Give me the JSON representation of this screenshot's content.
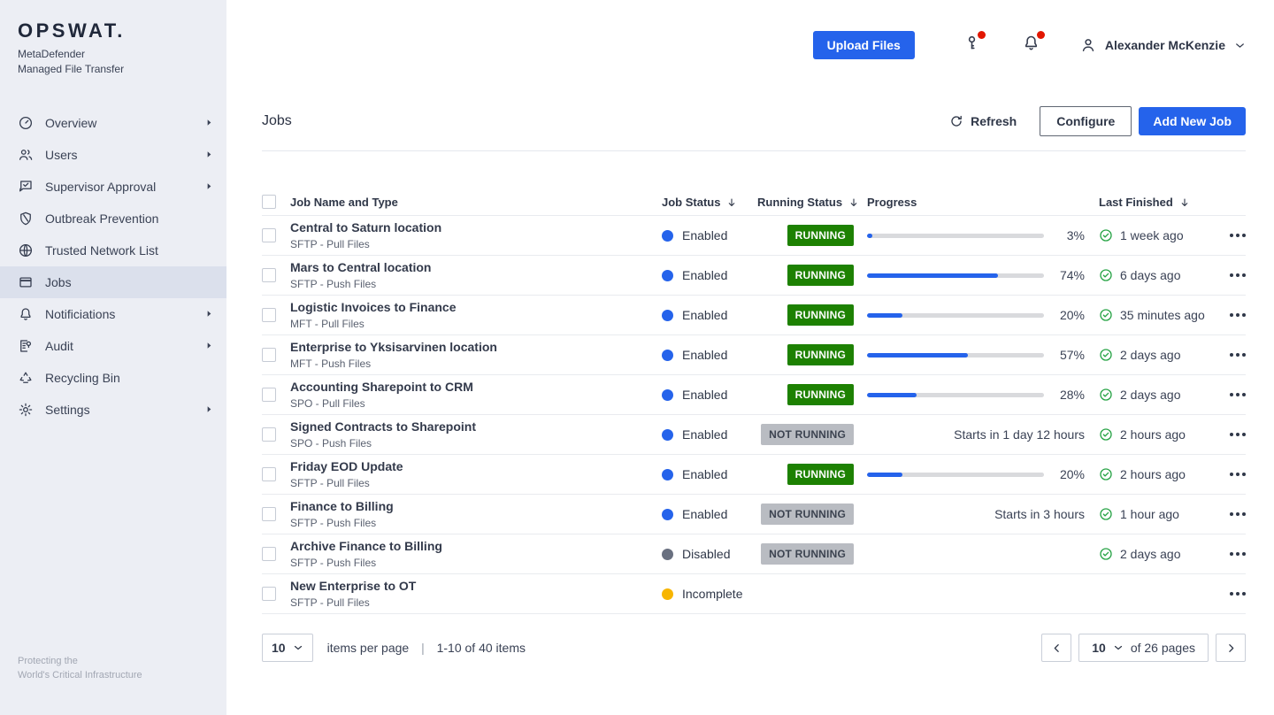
{
  "brand": {
    "logo": "OPSWAT.",
    "product1": "MetaDefender",
    "product2": "Managed File Transfer",
    "tagline1": "Protecting the",
    "tagline2": "World's Critical Infrastructure"
  },
  "sidebar": {
    "items": [
      {
        "label": "Overview",
        "icon": "gauge-icon",
        "submenu": true
      },
      {
        "label": "Users",
        "icon": "users-icon",
        "submenu": true
      },
      {
        "label": "Supervisor Approval",
        "icon": "approval-icon",
        "submenu": true
      },
      {
        "label": "Outbreak Prevention",
        "icon": "shield-icon",
        "submenu": false
      },
      {
        "label": "Trusted Network List",
        "icon": "globe-icon",
        "submenu": false
      },
      {
        "label": "Jobs",
        "icon": "window-icon",
        "submenu": false,
        "active": true
      },
      {
        "label": "Notificiations",
        "icon": "bell-icon",
        "submenu": true
      },
      {
        "label": "Audit",
        "icon": "audit-icon",
        "submenu": true
      },
      {
        "label": "Recycling Bin",
        "icon": "recycle-icon",
        "submenu": false
      },
      {
        "label": "Settings",
        "icon": "gear-icon",
        "submenu": true
      }
    ]
  },
  "header": {
    "upload_button": "Upload Files",
    "user_name": "Alexander McKenzie"
  },
  "toolbar": {
    "title": "Jobs",
    "refresh_label": "Refresh",
    "configure_label": "Configure",
    "add_job_label": "Add New Job"
  },
  "table": {
    "columns": {
      "name": "Job Name and Type",
      "job_status": "Job Status",
      "running_status": "Running Status",
      "progress": "Progress",
      "last_finished": "Last Finished"
    },
    "rows": [
      {
        "name": "Central to Saturn location",
        "type": "SFTP - Pull Files",
        "job_status": "Enabled",
        "running_status": "RUNNING",
        "progress_pct": 3,
        "progress_label": "3%",
        "starts_label": null,
        "last_finished": "1 week ago"
      },
      {
        "name": "Mars to Central location",
        "type": "SFTP - Push Files",
        "job_status": "Enabled",
        "running_status": "RUNNING",
        "progress_pct": 74,
        "progress_label": "74%",
        "starts_label": null,
        "last_finished": "6 days ago"
      },
      {
        "name": "Logistic Invoices to Finance",
        "type": "MFT - Pull Files",
        "job_status": "Enabled",
        "running_status": "RUNNING",
        "progress_pct": 20,
        "progress_label": "20%",
        "starts_label": null,
        "last_finished": "35 minutes ago"
      },
      {
        "name": "Enterprise to Yksisarvinen location",
        "type": "MFT - Push Files",
        "job_status": "Enabled",
        "running_status": "RUNNING",
        "progress_pct": 57,
        "progress_label": "57%",
        "starts_label": null,
        "last_finished": "2 days ago"
      },
      {
        "name": "Accounting Sharepoint to CRM",
        "type": "SPO - Pull Files",
        "job_status": "Enabled",
        "running_status": "RUNNING",
        "progress_pct": 28,
        "progress_label": "28%",
        "starts_label": null,
        "last_finished": "2 days ago"
      },
      {
        "name": "Signed Contracts to Sharepoint",
        "type": "SPO - Push Files",
        "job_status": "Enabled",
        "running_status": "NOT RUNNING",
        "progress_pct": null,
        "progress_label": null,
        "starts_label": "Starts in 1 day 12 hours",
        "last_finished": "2 hours ago"
      },
      {
        "name": "Friday EOD Update",
        "type": "SFTP - Pull Files",
        "job_status": "Enabled",
        "running_status": "RUNNING",
        "progress_pct": 20,
        "progress_label": "20%",
        "starts_label": null,
        "last_finished": "2 hours ago"
      },
      {
        "name": "Finance to Billing",
        "type": "SFTP - Push Files",
        "job_status": "Enabled",
        "running_status": "NOT RUNNING",
        "progress_pct": null,
        "progress_label": null,
        "starts_label": "Starts in 3 hours",
        "last_finished": "1 hour ago"
      },
      {
        "name": "Archive Finance to Billing",
        "type": "SFTP - Push Files",
        "job_status": "Disabled",
        "running_status": "NOT RUNNING",
        "progress_pct": null,
        "progress_label": null,
        "starts_label": null,
        "last_finished": "2 days ago"
      },
      {
        "name": "New Enterprise to OT",
        "type": "SFTP - Pull Files",
        "job_status": "Incomplete",
        "running_status": null,
        "progress_pct": null,
        "progress_label": null,
        "starts_label": null,
        "last_finished": null
      }
    ]
  },
  "status_colors": {
    "Enabled": "#2563eb",
    "Disabled": "#697080",
    "Incomplete": "#f7b500"
  },
  "pagination": {
    "page_size": "10",
    "items_per_page_label": "items per page",
    "separator": "|",
    "range_label": "1-10 of 40 items",
    "current_page": "10",
    "pages_label": "of 26 pages"
  }
}
